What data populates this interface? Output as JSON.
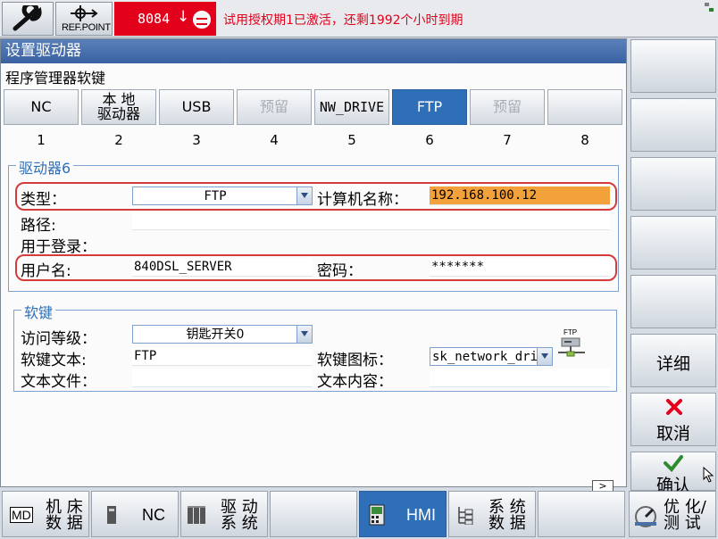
{
  "topbar": {
    "ref_point_label": "REF.POINT",
    "alarm_code": "8084",
    "alarm_arrow": "↓",
    "alarm_message": "试用授权期1已激活，还剩1992个小时到期"
  },
  "window": {
    "title": "设置驱动器",
    "subtitle": "程序管理器软键"
  },
  "softkeys": [
    {
      "label": "NC",
      "number": "1",
      "state": "normal"
    },
    {
      "label": "本 地 驱动器",
      "line1": "本 地",
      "line2": "驱动器",
      "number": "2",
      "state": "normal"
    },
    {
      "label": "USB",
      "number": "3",
      "state": "normal"
    },
    {
      "label": "预留",
      "number": "4",
      "state": "reserved"
    },
    {
      "label": "NW_DRIVE",
      "number": "5",
      "state": "normal"
    },
    {
      "label": "FTP",
      "number": "6",
      "state": "active"
    },
    {
      "label": "预留",
      "number": "7",
      "state": "reserved"
    },
    {
      "label": "",
      "number": "8",
      "state": "normal"
    }
  ],
  "drive_group": {
    "legend": "驱动器6",
    "type_label": "类型：",
    "type_value": "FTP",
    "computer_name_label": "计算机名称：",
    "computer_name_value": "192.168.100.12",
    "path_label": "路径:",
    "path_value": "",
    "login_label": "用于登录：",
    "username_label": "用户名:",
    "username_value": "840DSL_SERVER",
    "password_label": "密码：",
    "password_value": "*******"
  },
  "softkey_group": {
    "legend": "软键",
    "access_label": "访问等级：",
    "access_value": "钥匙开关0",
    "text_label": "软键文本:",
    "text_value": "FTP",
    "icon_label": "软键图标：",
    "icon_value": "sk_network_dri",
    "icon_preview_label": "FTP",
    "textfile_label": "文本文件：",
    "textfile_value": "",
    "textcontent_label": "文本内容：",
    "textcontent_value": ""
  },
  "right_keys": {
    "detail": "详细",
    "cancel": "取消",
    "ok": "确认"
  },
  "bottom_keys": {
    "machine_data": "机 床 数 据",
    "machine_line1": "机 床",
    "machine_line2": "数 据",
    "md_icon": "MD",
    "nc": "NC",
    "drive_line1": "驱 动",
    "drive_line2": "系 统",
    "hmi": "HMI",
    "system_line1": "系 统",
    "system_line2": "数 据",
    "optimize_line1": "优 化/",
    "optimize_line2": "测 试"
  },
  "scroll_label": ">",
  "colors": {
    "active": "#2f6fb8",
    "alarm": "#e3001b",
    "highlight_field": "#f3a13a",
    "callout": "#d43b3b"
  }
}
